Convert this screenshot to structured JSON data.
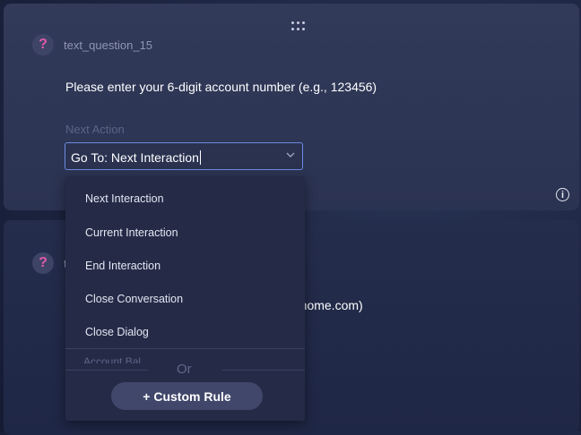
{
  "card1": {
    "question_name": "text_question_15",
    "prompt": "Please enter your 6-digit account number (e.g., 123456)",
    "next_action_label": "Next Action",
    "select_value": "Go To: Next Interaction"
  },
  "card2": {
    "question_name": "t",
    "prompt_fragment": ")home.com)"
  },
  "dropdown": {
    "items": [
      "Next Interaction",
      "Current Interaction",
      "End Interaction",
      "Close Conversation",
      "Close Dialog"
    ],
    "partial_item": "Account Bal",
    "or_text": "Or",
    "custom_rule_label": "+ Custom Rule"
  },
  "icons": {
    "question": "question-mark-icon",
    "info": "info-icon",
    "drag": "drag-handle-icon",
    "chevron": "chevron-down-icon"
  },
  "colors": {
    "accent_pink": "#e25aa8",
    "focus_border": "#6b8be0",
    "card_bg": "#323a5a"
  }
}
